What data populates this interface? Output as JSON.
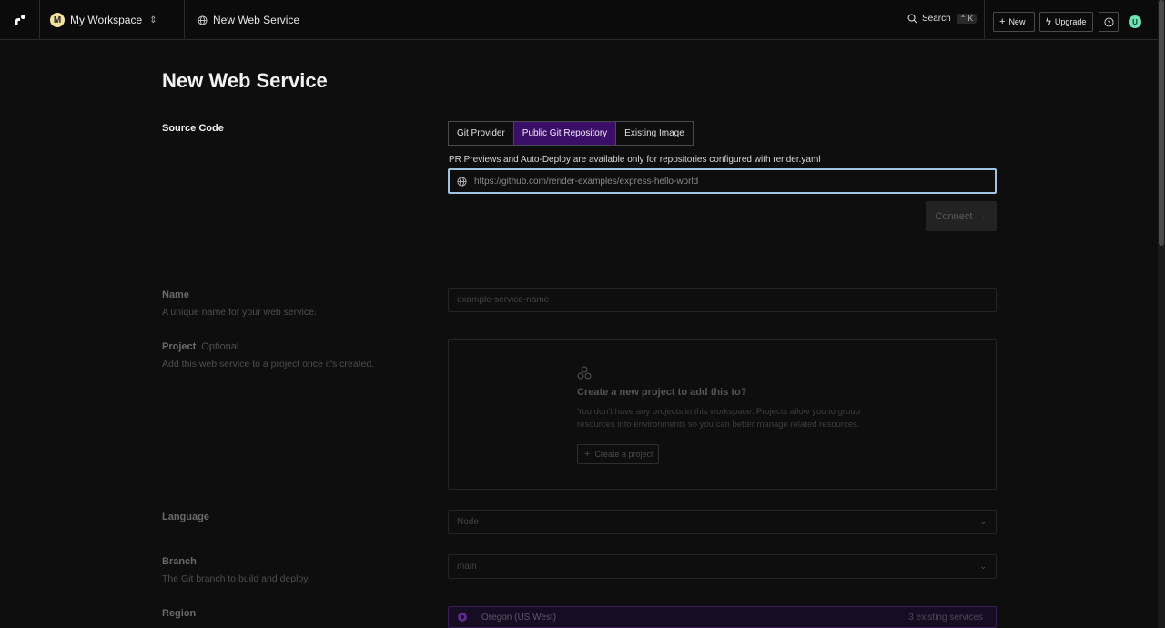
{
  "topbar": {
    "workspace": {
      "avatar_letter": "M",
      "name": "My Workspace"
    },
    "breadcrumb": "New Web Service",
    "search_label": "Search",
    "search_shortcut": "⌃ K",
    "new_label": "New",
    "upgrade_label": "Upgrade",
    "user_letter": "U"
  },
  "page": {
    "title": "New Web Service",
    "source_code": {
      "label": "Source Code",
      "tabs": [
        {
          "label": "Git Provider",
          "active": false
        },
        {
          "label": "Public Git Repository",
          "active": true
        },
        {
          "label": "Existing Image",
          "active": false
        }
      ],
      "hint": "PR Previews and Auto-Deploy are available only for repositories configured with render.yaml",
      "url_placeholder": "https://github.com/render-examples/express-hello-world",
      "connect_label": "Connect"
    },
    "name": {
      "label": "Name",
      "description": "A unique name for your web service.",
      "placeholder": "example-service-name"
    },
    "project": {
      "label": "Project",
      "optional": "Optional",
      "description": "Add this web service to a project once it's created.",
      "empty_title": "Create a new project to add this to?",
      "empty_desc": "You don't have any projects in this workspace. Projects allow you to group resources into environments so you can better manage related resources.",
      "create_label": "Create a project"
    },
    "language": {
      "label": "Language",
      "value": "Node"
    },
    "branch": {
      "label": "Branch",
      "description": "The Git branch to build and deploy.",
      "value": "main"
    },
    "region": {
      "label": "Region",
      "value": "Oregon (US West)",
      "count": "3 existing services"
    }
  },
  "colors": {
    "accent": "#3b0f68",
    "focus_border": "#9fc3e0",
    "user_avatar": "#6fe3b6",
    "workspace_avatar": "#f3e3a0"
  }
}
